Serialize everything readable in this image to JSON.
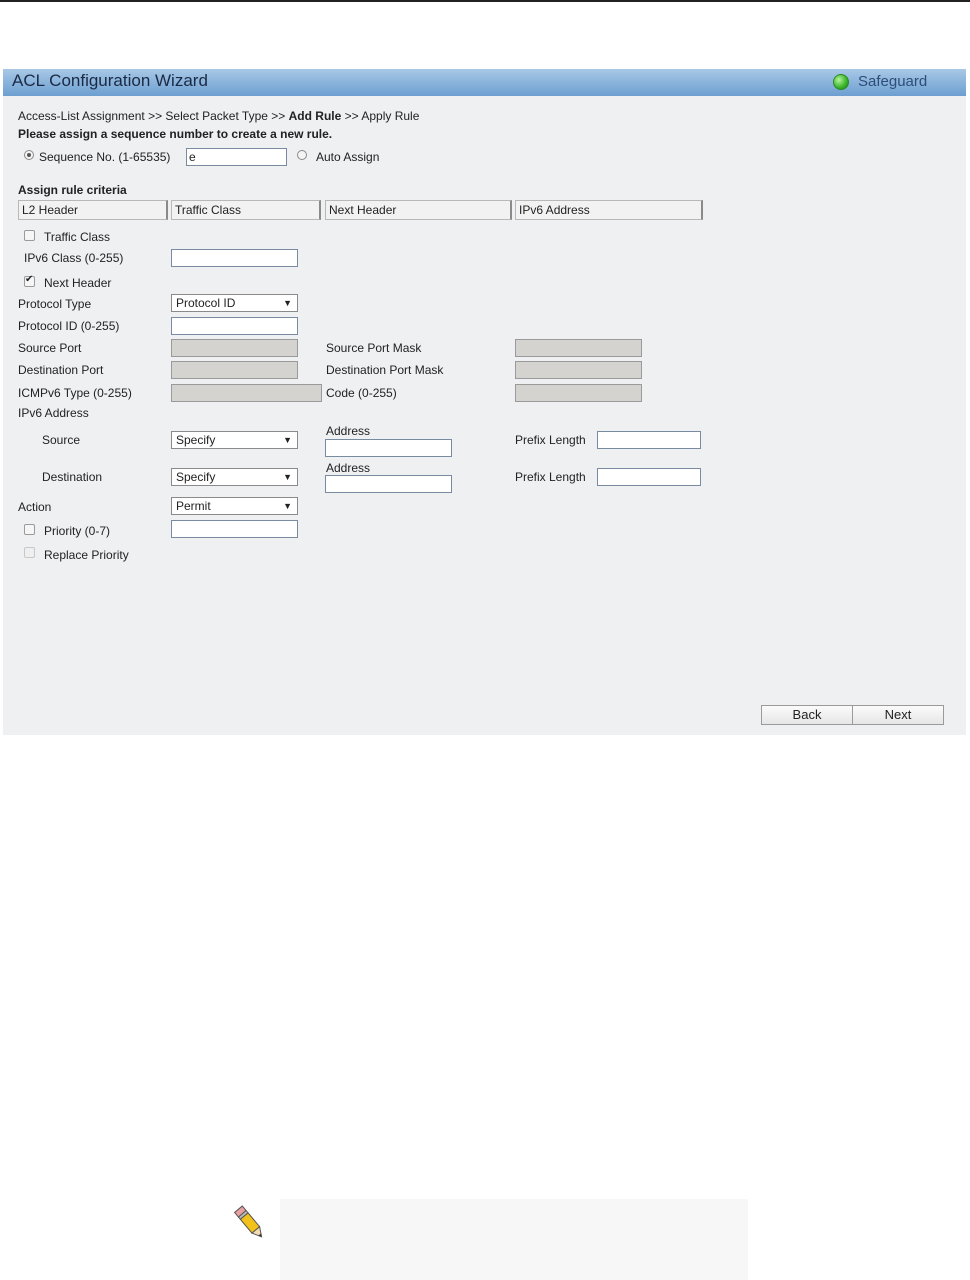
{
  "window": {
    "title": "ACL Configuration Wizard",
    "badge": "Safeguard",
    "badge_color": "#37b22a",
    "titlebar_color": "#6c9fd1"
  },
  "breadcrumb": {
    "step1": "Access-List Assignment",
    "sep": ">>",
    "step2": "Select Packet Type",
    "step3": "Add Rule",
    "step4": "Apply Rule"
  },
  "instructions": "Please assign a sequence number to create a new rule.",
  "sequence": {
    "label": "Sequence No. (1-65535)",
    "value": "e",
    "selected": true,
    "auto_label": "Auto Assign"
  },
  "criteria": {
    "heading": "Assign rule criteria",
    "tabs": [
      "L2 Header",
      "Traffic Class",
      "Next Header",
      "IPv6 Address"
    ]
  },
  "traffic_class": {
    "checkbox_label": "Traffic Class",
    "class_label": "IPv6 Class (0-255)",
    "class_value": ""
  },
  "next_header": {
    "checkbox_label": "Next Header",
    "checked": true,
    "protocol_type_label": "Protocol Type",
    "protocol_type_value": "Protocol ID",
    "protocol_id_label": "Protocol ID (0-255)",
    "protocol_id_value": "",
    "source_port_label": "Source Port",
    "source_port_mask_label": "Source Port Mask",
    "dest_port_label": "Destination Port",
    "dest_port_mask_label": "Destination Port Mask",
    "icmp_type_label": "ICMPv6 Type (0-255)",
    "code_label": "Code (0-255)"
  },
  "ipv6": {
    "heading": "IPv6 Address",
    "source_label": "Source",
    "source_value": "Specify",
    "dest_label": "Destination",
    "dest_value": "Specify",
    "address_label": "Address",
    "prefix_label": "Prefix Length"
  },
  "action": {
    "label": "Action",
    "value": "Permit"
  },
  "priority": {
    "label": "Priority  (0-7)",
    "value": "",
    "replace_label": "Replace Priority"
  },
  "buttons": {
    "back": "Back",
    "next": "Next"
  }
}
